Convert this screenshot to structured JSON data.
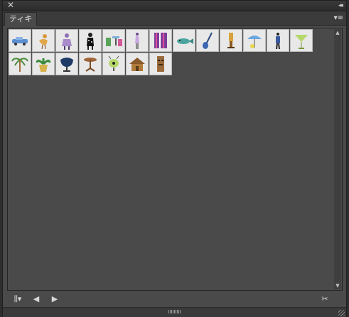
{
  "window": {
    "close_glyph": "✕",
    "collapse_glyph": "◂◂"
  },
  "tab": {
    "label": "ティキ",
    "menu_glyph": "▾≡"
  },
  "symbols": [
    {
      "name": "car",
      "icon": "car-icon"
    },
    {
      "name": "bird",
      "icon": "bird-icon"
    },
    {
      "name": "figure-purple",
      "icon": "figure-icon"
    },
    {
      "name": "figure-black",
      "icon": "figure-icon"
    },
    {
      "name": "table-chairs",
      "icon": "furniture-icon"
    },
    {
      "name": "woman",
      "icon": "figure-icon"
    },
    {
      "name": "pattern-poster",
      "icon": "poster-icon"
    },
    {
      "name": "fish",
      "icon": "fish-icon"
    },
    {
      "name": "guitar",
      "icon": "guitar-icon"
    },
    {
      "name": "tiki-lamp",
      "icon": "lamp-icon"
    },
    {
      "name": "umbrella",
      "icon": "umbrella-icon"
    },
    {
      "name": "man",
      "icon": "figure-icon"
    },
    {
      "name": "cocktail",
      "icon": "cocktail-icon"
    },
    {
      "name": "palm-tree",
      "icon": "palm-icon"
    },
    {
      "name": "potted-plant",
      "icon": "plant-icon"
    },
    {
      "name": "egg-chair",
      "icon": "chair-icon"
    },
    {
      "name": "side-table",
      "icon": "table-icon"
    },
    {
      "name": "eye-lamp",
      "icon": "lamp-icon"
    },
    {
      "name": "tiki-hut",
      "icon": "hut-icon"
    },
    {
      "name": "tiki-statue",
      "icon": "statue-icon"
    }
  ],
  "footer": {
    "library_glyph": "⫼▾",
    "prev_glyph": "◀",
    "next_glyph": "▶",
    "break_link_glyph": "✂"
  },
  "scroll": {
    "up_glyph": "▲",
    "down_glyph": "▼"
  }
}
